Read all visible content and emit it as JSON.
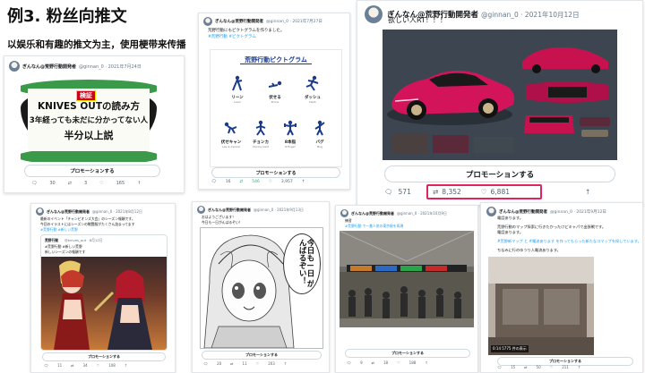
{
  "slide": {
    "title": "例3. 粉丝向推文",
    "subtitle": "以娱乐和有趣的推文为主，使用梗带来传播"
  },
  "colors": {
    "accent_green": "#17bf63",
    "highlight_red": "#e0245e",
    "pink_car": "#d4145a"
  },
  "account": {
    "name": "ぎんなん@荒野行動開発者",
    "handle": "@ginnan_0"
  },
  "tweet1": {
    "meta": "@ginnan_0 · 2021年7月24日",
    "img_badge": "検証",
    "img_line1": "KNIVES OUTの読み方",
    "img_line2": "3年経っても未だに分かってない人",
    "img_line3": "半分以上説",
    "promo": "プロモーションする",
    "replies": "30",
    "retweets": "3",
    "likes": "165"
  },
  "tweet2": {
    "meta": "@ginnan_0 · 2021年7月27日",
    "text": "荒野行動にもピクトグラムを作りました。",
    "hashtags": "#荒野行動 #ピクトグラム",
    "img_title": "荒野行動ピクトグラム",
    "pictos": [
      {
        "label": "リーン",
        "sub": "Lean"
      },
      {
        "label": "伏せる",
        "sub": "Prone"
      },
      {
        "label": "ダッシュ",
        "sub": "Dash"
      },
      {
        "label": "伏せキャン",
        "sub": "Lay & Cancel"
      },
      {
        "label": "チョンカ",
        "sub": "Choice Card"
      },
      {
        "label": "8本指",
        "sub": "8-finger"
      },
      {
        "label": "バグ",
        "sub": "Bug"
      }
    ],
    "promo": "プロモーションする",
    "replies": "16",
    "retweets": "546",
    "likes": "3,957"
  },
  "tweet3": {
    "meta": "@ginnan_0 · 2021年10月12日",
    "text": "欲しい人RT！！！",
    "promo": "プロモーションする",
    "replies": "571",
    "retweets": "8,352",
    "likes": "6,881"
  },
  "tweet4": {
    "meta": "@ginnan_0 · 2021年8月12日",
    "text1": "最新のイベント「チャンピオンズ大会」のシーズン報酬です。",
    "text2": "今回のイラストにはシーズンの戦闘服がたくさん詰まってます",
    "text3": "#荒野行動 #新しい荒野",
    "quote_name": "荒野行動",
    "quote_meta": "@knives_out · 8月12日",
    "quote_text": "#荒野行動 #新しい荒野",
    "quote_text2": "新しいシーズンの報酬です",
    "promo": "プロモーションする",
    "replies": "11",
    "retweets": "34",
    "likes": "108"
  },
  "tweet5": {
    "meta": "@ginnan_0 · 2021年9月13日",
    "text1": "おはようございます！",
    "text2": "今日も一日がんばるぞい！",
    "bubble": "今日も一日 がんばるぞい！",
    "promo": "プロモーションする",
    "replies": "20",
    "retweets": "11",
    "likes": "203"
  },
  "tweet6": {
    "meta": "@ginnan_0 · 2021年10月9日",
    "text1": "練習",
    "text2": "#荒野行動 で一番人気の東京駅を再現",
    "promo": "プロモーションする",
    "replies": "9",
    "retweets": "18",
    "likes": "188"
  },
  "tweet7": {
    "meta": "@ginnan_0 · 2021年9月12日",
    "text1": "電話あります。",
    "text2": "荒野行動のマップ探索に行きたかったけどキャパで出張戦です。",
    "text3": "電話あります。",
    "text4": "#荒野新マップ と #電流あります を作ってもらった新たなコマップを探しています。",
    "text5": "ちなみに行のゆうり人電流あります。",
    "video_time": "0:14",
    "video_views": "5775 件の表示",
    "promo": "プロモーションする",
    "replies": "15",
    "retweets": "50",
    "likes": "211"
  }
}
